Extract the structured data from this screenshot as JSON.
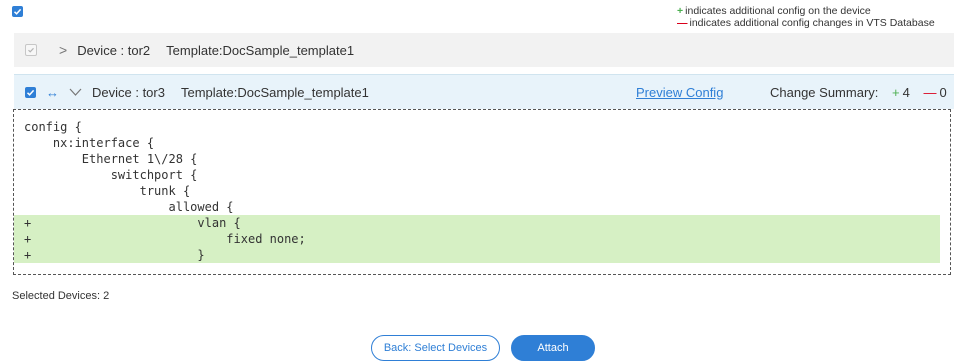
{
  "legend": {
    "plus_symbol": "+",
    "plus_text": "indicates additional config on the device",
    "minus_symbol": "—",
    "minus_text": "indicates additional config changes in VTS Database"
  },
  "devices": [
    {
      "device_label": "Device : tor2",
      "template_label": "Template:DocSample_template1",
      "checked": true,
      "expanded": false
    },
    {
      "device_label": "Device : tor3",
      "template_label": "Template:DocSample_template1",
      "checked": true,
      "expanded": true,
      "preview_label": "Preview Config",
      "change_summary_label": "Change Summary:",
      "plus_symbol": "+",
      "added_count": "4",
      "minus_symbol": "—",
      "removed_count": "0"
    }
  ],
  "config_lines": [
    {
      "mark": "",
      "text": "config {"
    },
    {
      "mark": "",
      "text": "    nx:interface {"
    },
    {
      "mark": "",
      "text": "        Ethernet 1\\/28 {"
    },
    {
      "mark": "",
      "text": "            switchport {"
    },
    {
      "mark": "",
      "text": "                trunk {"
    },
    {
      "mark": "",
      "text": "                    allowed {"
    },
    {
      "mark": "+",
      "text": "                        vlan {"
    },
    {
      "mark": "+",
      "text": "                            fixed none;"
    },
    {
      "mark": "+",
      "text": "                        }"
    }
  ],
  "selected_devices_label": "Selected Devices: 2",
  "buttons": {
    "back_label": "Back: Select Devices",
    "attach_label": "Attach"
  },
  "colors": {
    "accent": "#2f7fd6",
    "added_bg": "#d6f0c4",
    "plus": "#4caf50",
    "minus": "#d9001b"
  }
}
